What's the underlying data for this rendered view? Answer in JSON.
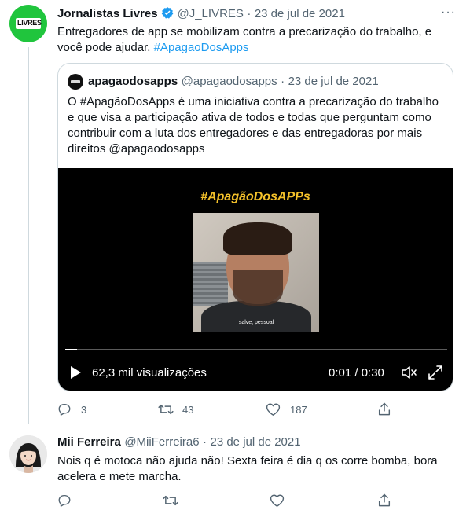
{
  "tweet1": {
    "author_name": "Jornalistas Livres",
    "handle": "@J_LIVRES",
    "separator": "·",
    "date": "23 de jul de 2021",
    "more": "···",
    "avatar_text": "LIVRES",
    "text_line1": "Entregadores de app se mobilizam contra a precarização do trabalho, e",
    "text_line2_prefix": "você pode ajudar. ",
    "hashtag": "#ApagaoDosApps",
    "quote": {
      "author_name": "apagaodosapps",
      "handle": "@apagaodosapps",
      "separator": "·",
      "date": "23 de jul de 2021",
      "lines": [
        "O #ApagãoDosApps é uma iniciativa contra a precarização do trabalho",
        "e que visa a participação ativa de todos e todas que perguntam como",
        "contribuir com a luta dos entregadores e das entregadoras por mais",
        "direitos @apagaodosapps"
      ],
      "video": {
        "title": "#ApagãoDosAPPs",
        "caption": "salve, pessoal",
        "views": "62,3 mil visualizações",
        "time": "0:01 / 0:30",
        "progress": 0.03
      }
    },
    "actions": {
      "replies": "3",
      "retweets": "43",
      "likes": "187"
    }
  },
  "tweet2": {
    "author_name": "Mii Ferreira",
    "handle": "@MiiFerreira6",
    "separator": "·",
    "date": "23 de jul de 2021",
    "text_line1": "Nois q é motoca não ajuda não! Sexta feira é dia q os corre bomba, bora",
    "text_line2": "acelera e mete marcha."
  },
  "colors": {
    "accent": "#1d9bf0",
    "muted": "#536471",
    "avatar_green": "#20c53d",
    "video_title": "#f4c12a"
  }
}
